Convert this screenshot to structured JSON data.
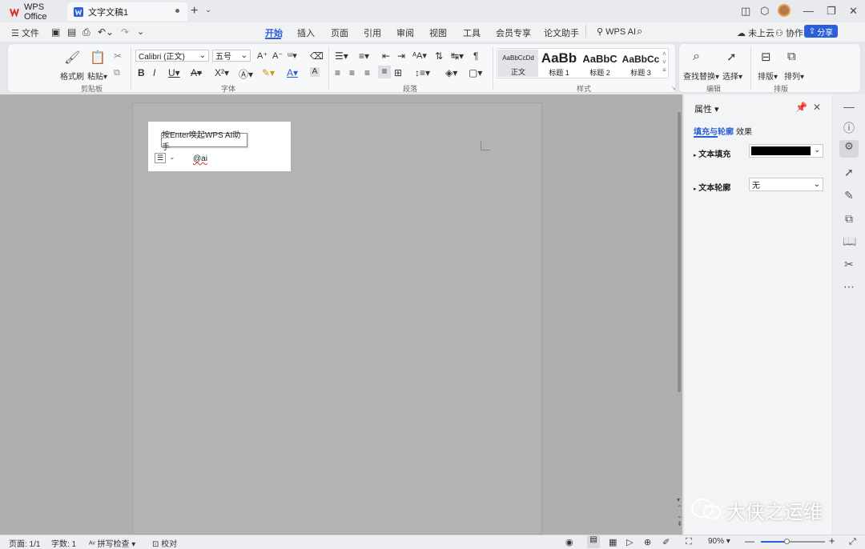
{
  "titlebar": {
    "tabs": [
      {
        "label": "WPS Office"
      },
      {
        "label": "文字文稿1"
      }
    ],
    "new_tab": "+",
    "new_tab_dropdown": "⌄"
  },
  "menubar": {
    "file": "文件",
    "items": [
      "开始",
      "插入",
      "页面",
      "引用",
      "审阅",
      "视图",
      "工具",
      "会员专享",
      "论文助手"
    ],
    "wps_ai": "WPS AI",
    "cloud": "未上云",
    "collab": "协作",
    "share": "分享"
  },
  "ribbon": {
    "clipboard": {
      "format_painter": "格式刷",
      "paste": "粘贴",
      "label": "剪贴板"
    },
    "font": {
      "name": "Calibri (正文)",
      "size": "五号",
      "label": "字体"
    },
    "paragraph": {
      "label": "段落"
    },
    "styles": {
      "label": "样式",
      "items": [
        {
          "preview": "AaBbCcDd",
          "name": "正文"
        },
        {
          "preview": "AaBb",
          "name": "标题 1"
        },
        {
          "preview": "AaBbC",
          "name": "标题 2"
        },
        {
          "preview": "AaBbCc",
          "name": "标题 3"
        }
      ]
    },
    "edit": {
      "find_replace": "查找替换",
      "select": "选择",
      "label": "编辑"
    },
    "arrange": {
      "arrange_btn": "排版",
      "sort_btn": "排列",
      "label": "排版"
    }
  },
  "document": {
    "ai_hint": "按Enter唤起WPS AI助手",
    "typed_text": "@ai"
  },
  "panel": {
    "title": "属性",
    "tabs": [
      "填充与轮廓",
      "效果"
    ],
    "text_fill_label": "文本填充",
    "text_fill_color": "#000000",
    "text_outline_label": "文本轮廓",
    "text_outline_value": "无"
  },
  "status": {
    "page": "页面: 1/1",
    "words": "字数: 1",
    "spell": "拼写检查",
    "proof": "校对",
    "zoom": "90%"
  },
  "watermark": "大侠之运维",
  "colors": {
    "accent": "#2b5fd9",
    "wps_red": "#d9322b"
  }
}
